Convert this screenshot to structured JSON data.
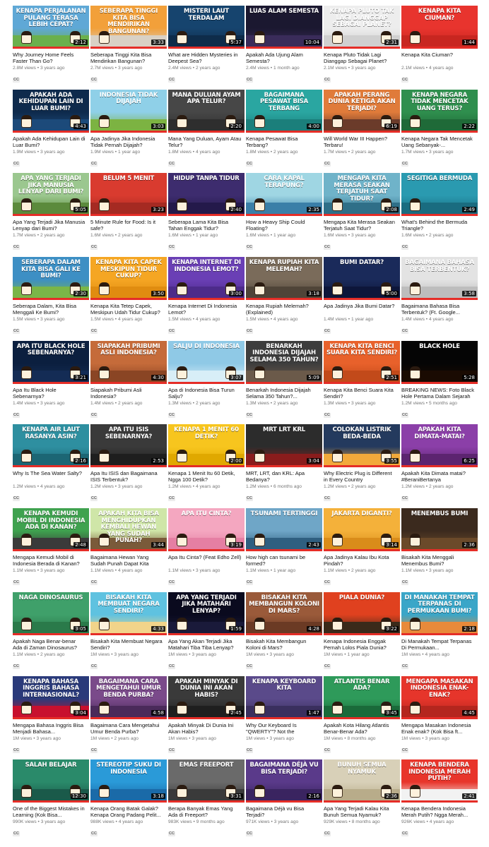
{
  "videos": [
    {
      "title": "Why Journey Home Feels Faster Than Go?",
      "overlay": "KENAPA PERJALANAN PULANG TERASA LEBIH CEPAT?",
      "duration": "2:12",
      "meta": "2.8M views • 3 years ago",
      "badge": "CC",
      "colors": [
        "#5fa8d6",
        "#6ab04c"
      ]
    },
    {
      "title": "Seberapa Tinggi Kita Bisa Mendirikan Bangunan?",
      "overlay": "SEBERAPA TINGGI KITA BISA MENDIRIKAN BANGUNAN?",
      "duration": "3:33",
      "meta": "2.7M views • 3 years ago",
      "badge": "CC",
      "colors": [
        "#f2a03a",
        "#d9d1c5"
      ]
    },
    {
      "title": "What are Hidden Mysteries in Deepest Sea?",
      "overlay": "MISTERI LAUT TERDALAM",
      "duration": "5:37",
      "meta": "2.4M views • 2 years ago",
      "badge": "CC",
      "colors": [
        "#16446e",
        "#0e2c4a"
      ]
    },
    {
      "title": "Apakah Ada Ujung Alam Semesta?",
      "overlay": "LUAS ALAM SEMESTA",
      "duration": "10:04",
      "meta": "2.4M views • 1 month ago",
      "badge": "CC",
      "colors": [
        "#1b1830",
        "#3a2c5a"
      ]
    },
    {
      "title": "Kenapa Pluto Tidak Lagi Dianggap Sebagai Planet?",
      "overlay": "KENAPA PLUTO TAK LAGI DIANGGAP SEBAGAI PLANET?",
      "duration": "2:31",
      "meta": "2.1M views • 3 years ago",
      "badge": "CC",
      "colors": [
        "#ededed",
        "#d0d0d0"
      ]
    },
    {
      "title": "Kenapa Kita Ciuman?",
      "overlay": "KENAPA KITA CIUMAN?",
      "duration": "1:44",
      "meta": "2.1M views • 4 years ago",
      "badge": "CC",
      "colors": [
        "#e8342e",
        "#c82620"
      ]
    },
    {
      "title": "Apakah Ada Kehidupan Lain di Luar Bumi?",
      "overlay": "APAKAH ADA KEHIDUPAN LAIN DI LUAR BUMI?",
      "duration": "4:43",
      "meta": "1.9M views • 3 years ago",
      "badge": "CC",
      "colors": [
        "#0e2a4c",
        "#1c4a7a"
      ]
    },
    {
      "title": "Apa Jadinya Jika Indonesia Tidak Pernah Dijajah?",
      "overlay": "INDONESIA TIDAK DIJAJAH",
      "duration": "3:03",
      "meta": "1.9M views • 1 year ago",
      "badge": "CC",
      "colors": [
        "#8fd0e8",
        "#7cb342"
      ]
    },
    {
      "title": "Mana Yang Duluan, Ayam Atau Telur?",
      "overlay": "MANA DULUAN AYAM APA TELUR?",
      "duration": "2:20",
      "meta": "1.8M views • 4 years ago",
      "badge": "CC",
      "colors": [
        "#474747",
        "#2e2e2e"
      ]
    },
    {
      "title": "Kenapa Pesawat Bisa Terbang?",
      "overlay": "BAGAIMANA PESAWAT BISA TERBANG",
      "duration": "4:00",
      "meta": "1.8M views • 2 years ago",
      "badge": "CC",
      "colors": [
        "#2aa6a1",
        "#1b7f7b"
      ]
    },
    {
      "title": "Will World War III Happen? Terbaru!",
      "overlay": "APAKAH PERANG DUNIA KETIGA AKAN TERJADI?",
      "duration": "6:19",
      "meta": "1.7M views • 2 years ago",
      "badge": "CC",
      "colors": [
        "#e07b3a",
        "#6b3b2a"
      ]
    },
    {
      "title": "Kenapa Negara Tak Mencetak Uang Sebanyak-...",
      "overlay": "KENAPA NEGARA TIDAK MENCETAK UANG TERUS?",
      "duration": "2:22",
      "meta": "1.7M views • 3 years ago",
      "badge": "CC",
      "colors": [
        "#2f8f4e",
        "#1f6a38"
      ]
    },
    {
      "title": "Apa Yang Terjadi Jika Manusia Lenyap dari Bumi?",
      "overlay": "APA YANG TERJADI JIKA MANUSIA LENYAP DARI BUMI?",
      "duration": "5:05",
      "meta": "1.7M views • 2 years ago",
      "badge": "CC",
      "colors": [
        "#9bc78f",
        "#5b8a3c"
      ]
    },
    {
      "title": "5 Minute Rule for Food: Is it safe?",
      "overlay": "BELUM 5 MENIT",
      "duration": "3:23",
      "meta": "1.6M views • 2 years ago",
      "badge": "CC",
      "colors": [
        "#d93b2f",
        "#a52a22"
      ]
    },
    {
      "title": "Seberapa Lama Kita Bisa Tahan Enggak Tidur?",
      "overlay": "HIDUP TANPA TIDUR",
      "duration": "2:40",
      "meta": "1.6M views • 1 year ago",
      "badge": "CC",
      "colors": [
        "#3d2c6e",
        "#24194a"
      ]
    },
    {
      "title": "How a Heavy Ship Could Floating?",
      "overlay": "CARA KAPAL TERAPUNG?",
      "duration": "2:35",
      "meta": "1.6M views • 1 year ago",
      "badge": "CC",
      "colors": [
        "#9fd6e3",
        "#3a7fa8"
      ]
    },
    {
      "title": "Mengapa Kita Merasa Seakan Terjatuh Saat Tidur?",
      "overlay": "MENGAPA KITA MERASA SEAKAN TERJATUH SAAT TIDUR?",
      "duration": "2:08",
      "meta": "1.6M views • 3 years ago",
      "badge": "CC",
      "colors": [
        "#6fb3c9",
        "#2f6f88"
      ]
    },
    {
      "title": "What's Behind the Bermuda Triangle?",
      "overlay": "SEGITIGA BERMUDA",
      "duration": "2:49",
      "meta": "1.6M views • 2 years ago",
      "badge": "CC",
      "colors": [
        "#2a9ab0",
        "#1a6c80"
      ]
    },
    {
      "title": "Seberapa Dalam, Kita Bisa Menggali Ke Bumi?",
      "overlay": "SEBERAPA DALAM KITA BISA GALI KE BUMI?",
      "duration": "2:30",
      "meta": "1.5M views • 3 years ago",
      "badge": "CC",
      "colors": [
        "#3d8fc4",
        "#7ab648"
      ]
    },
    {
      "title": "Kenapa Kita Tetep Capek, Meskipun Udah Tidur Cukup?",
      "overlay": "KENAPA KITA CAPEK MESKIPUN TIDUR CUKUP?",
      "duration": "3:50",
      "meta": "1.5M views • 4 years ago",
      "badge": "CC",
      "colors": [
        "#f5a623",
        "#e08c10"
      ]
    },
    {
      "title": "Kenapa Internet Di Indonesia Lemot?",
      "overlay": "KENAPA INTERNET DI INDONESIA LEMOT?",
      "duration": "3:00",
      "meta": "1.5M views • 4 years ago",
      "badge": "CC",
      "colors": [
        "#6a3fb5",
        "#4d2b8a"
      ]
    },
    {
      "title": "Kenapa Rupiah Melemah? (Explained)",
      "overlay": "KENAPA RUPIAH KITA MELEMAH?",
      "duration": "3:18",
      "meta": "1.5M views • 4 years ago",
      "badge": "CC",
      "colors": [
        "#7a6b5a",
        "#4f4438"
      ]
    },
    {
      "title": "Apa Jadinya Jika Bumi Datar?",
      "overlay": "BUMI DATAR?",
      "duration": "5:00",
      "meta": "1.4M views • 1 year ago",
      "badge": "CC",
      "colors": [
        "#1a2a5a",
        "#0d163a"
      ]
    },
    {
      "title": "Bagaimana Bahasa Bisa Terbentuk? (Ft. Google...",
      "overlay": "BAGAIMANA BAHASA BISA TERBENTUK?",
      "duration": "3:58",
      "meta": "1.4M views • 4 years ago",
      "badge": "CC",
      "colors": [
        "#e3e3e3",
        "#bdbdbd"
      ]
    },
    {
      "title": "Apa Itu Black Hole Sebenarnya?",
      "overlay": "APA ITU BLACK HOLE SEBENARNYA?",
      "duration": "3:21",
      "meta": "1.4M views • 3 years ago",
      "badge": "CC",
      "colors": [
        "#0b1f3f",
        "#142c55"
      ]
    },
    {
      "title": "Siapakah Pribumi Asli Indonesia?",
      "overlay": "SIAPAKAH PRIBUMI ASLI INDONESIA?",
      "duration": "4:30",
      "meta": "1.4M views • 2 years ago",
      "badge": "CC",
      "colors": [
        "#c56b3a",
        "#8a4524"
      ]
    },
    {
      "title": "Apa di Indonesia Bisa Turun Salju?",
      "overlay": "SALJU DI INDONESIA",
      "duration": "3:07",
      "meta": "1.3M views • 2 years ago",
      "badge": "CC",
      "colors": [
        "#8fc9e6",
        "#d8eef7"
      ]
    },
    {
      "title": "Benarkah Indonesia Dijajah Selama 350 Tahun?...",
      "overlay": "BENARKAH INDONESIA DIJAJAH SELAMA 350 TAHUN?",
      "duration": "5:09",
      "meta": "1.3M views • 2 years ago",
      "badge": "CC",
      "colors": [
        "#3d3d3d",
        "#6b5a4a"
      ]
    },
    {
      "title": "Kenapa Kita Benci Suara Kita Sendiri?",
      "overlay": "KENAPA KITA BENCI SUARA KITA SENDIRI?",
      "duration": "2:51",
      "meta": "1.3M views • 3 years ago",
      "badge": "CC",
      "colors": [
        "#e8612b",
        "#c24a1a"
      ]
    },
    {
      "title": "BREAKING NEWS: Foto Black Hole Pertama Dalam Sejarah",
      "overlay": "BLACK HOLE",
      "duration": "5:28",
      "meta": "1.2M views • 5 months ago",
      "badge": "CC",
      "colors": [
        "#050505",
        "#1a0b02"
      ]
    },
    {
      "title": "Why Is The Sea Water Salty?",
      "overlay": "KENAPA AIR LAUT RASANYA ASIN?",
      "duration": "2:16",
      "meta": "1.2M views • 4 years ago",
      "badge": "CC",
      "colors": [
        "#2e8fa0",
        "#1c6674"
      ]
    },
    {
      "title": "Apa Itu ISIS dan Bagaimana ISIS Terbentuk?",
      "overlay": "APA ITU ISIS SEBENARNYA?",
      "duration": "2:53",
      "meta": "1.2M views • 3 years ago",
      "badge": "CC",
      "colors": [
        "#3a3a3a",
        "#1e1e1e"
      ]
    },
    {
      "title": "Kenapa 1 Menit Itu 60 Detik, Ngga 100 Detik?",
      "overlay": "KENAPA 1 MENIT 60 DETIK?",
      "duration": "2:00",
      "meta": "1.2M views • 4 years ago",
      "badge": "CC",
      "colors": [
        "#f7c51e",
        "#e0a800"
      ]
    },
    {
      "title": "MRT, LRT, dan KRL: Apa Bedanya?",
      "overlay": "MRT LRT KRL",
      "duration": "3:04",
      "meta": "1.2M views • 6 months ago",
      "badge": "CC",
      "colors": [
        "#2c2c2c",
        "#8a1c1c"
      ]
    },
    {
      "title": "Why Electric Plug is Different in Every Country",
      "overlay": "COLOKAN LISTRIK BEDA-BEDA",
      "duration": "3:55",
      "meta": "1.2M views • 2 years ago",
      "badge": "CC",
      "colors": [
        "#243a5e",
        "#f2a93b"
      ]
    },
    {
      "title": "Apakah Kita Dimata matai? #BeraniBertanya",
      "overlay": "APAKAH KITA DIMATA-MATAI?",
      "duration": "6:25",
      "meta": "1.2M views • 2 years ago",
      "badge": "CC",
      "colors": [
        "#8b3fa8",
        "#5c2470"
      ]
    },
    {
      "title": "Mengapa Kemudi Mobil di Indonesia Berada di Kanan?",
      "overlay": "KENAPA KEMUDI MOBIL DI INDONESIA ADA DI KANAN?",
      "duration": "2:48",
      "meta": "1.1M views • 3 years ago",
      "badge": "CC",
      "colors": [
        "#3fa24f",
        "#3a3a3a"
      ]
    },
    {
      "title": "Bagaimana Hewan Yang Sudah Punah Dapat Kita Hidupkan...",
      "overlay": "APAKAH KITA BISA MENGHIDUPKAN KEMBALI HEWAN YANG SUDAH PUNAH?",
      "duration": "3:44",
      "meta": "1.1M views • 4 years ago",
      "badge": "CC",
      "colors": [
        "#cfe6a8",
        "#7a5a3a"
      ]
    },
    {
      "title": "Apa Itu Cinta? (Feat Edho Zell)",
      "overlay": "APA ITU CINTA?",
      "duration": "3:19",
      "meta": "1.1M views • 3 years ago",
      "badge": "CC",
      "colors": [
        "#f4a7c0",
        "#e57fa3"
      ]
    },
    {
      "title": "How high can tsunami be formed?",
      "overlay": "TSUNAMI TERTINGGI",
      "duration": "2:43",
      "meta": "1.1M views • 1 year ago",
      "badge": "CC",
      "colors": [
        "#6fa6c7",
        "#2f5f80"
      ]
    },
    {
      "title": "Apa Jadinya Kalau Ibu Kota Pindah?",
      "overlay": "JAKARTA DIGANTI?",
      "duration": "3:14",
      "meta": "1.1M views • 2 years ago",
      "badge": "CC",
      "colors": [
        "#f4b13a",
        "#d98c1a"
      ]
    },
    {
      "title": "Bisakah Kita Menggali Menembus Bumi?",
      "overlay": "MENEMBUS BUMI",
      "duration": "2:36",
      "meta": "1.1M views • 3 years ago",
      "badge": "CC",
      "colors": [
        "#3b2a1e",
        "#6b4a2a"
      ]
    },
    {
      "title": "Apakah Naga Benar-benar Ada di Zaman Dinosaurus?",
      "overlay": "NAGA DINOSAURUS",
      "duration": "3:05",
      "meta": "1.1M views • 2 years ago",
      "badge": "CC",
      "colors": [
        "#3fa06a",
        "#2a7a4a"
      ]
    },
    {
      "title": "Bisakah Kita Membuat Negara Sendiri?",
      "overlay": "BISAKAH KITA MEMBUAT NEGARA SENDIRI?",
      "duration": "4:33",
      "meta": "1M views • 3 years ago",
      "badge": "CC",
      "colors": [
        "#5fc2e0",
        "#f2d48a"
      ]
    },
    {
      "title": "Apa Yang Akan Terjadi Jika Matahari Tiba Tiba Lenyap?",
      "overlay": "APA YANG TERJADI JIKA MATAHARI LENYAP?",
      "duration": "1:59",
      "meta": "1M views • 3 years ago",
      "badge": "CC",
      "colors": [
        "#0a0a1e",
        "#1a1a3a"
      ]
    },
    {
      "title": "Bisakah Kita Membangun Koloni di Mars?",
      "overlay": "BISAKAH KITA MEMBANGUN KOLONI DI MARS?",
      "duration": "4:28",
      "meta": "1M views • 3 years ago",
      "badge": "CC",
      "colors": [
        "#9a5a3a",
        "#6b3a24"
      ]
    },
    {
      "title": "Kenapa Indonesia Enggak Pernah Lolos Piala Dunia?",
      "overlay": "PIALA DUNIA?",
      "duration": "3:22",
      "meta": "1M views • 1 year ago",
      "badge": "CC",
      "colors": [
        "#e0411f",
        "#3a2a1a"
      ]
    },
    {
      "title": "Di Manakah Tempat Terpanas Di Permukaan...",
      "overlay": "DI MANAKAH TEMPAT TERPANAS DI PERMUKAAN BUMI?",
      "duration": "2:18",
      "meta": "1M views • 4 years ago",
      "badge": "CC",
      "colors": [
        "#3aa6c8",
        "#e88a3a"
      ]
    },
    {
      "title": "Mengapa Bahasa Inggris Bisa Menjadi Bahasa...",
      "overlay": "KENAPA BAHASA INGGRIS BAHASA INTERNASIONAL?",
      "duration": "3:04",
      "meta": "1M views • 3 years ago",
      "badge": "CC",
      "colors": [
        "#2a3a7a",
        "#c8102e"
      ]
    },
    {
      "title": "Bagaimana Cara Mengetahui Umur Benda Purba?",
      "overlay": "BAGAIMANA CARA MENGETAHUI UMUR BENDA PURBA?",
      "duration": "4:58",
      "meta": "1M views • 2 years ago",
      "badge": "CC",
      "colors": [
        "#7a4a8a",
        "#4a2a5a"
      ]
    },
    {
      "title": "Apakah Minyak Di Dunia Ini Akan Habis?",
      "overlay": "APAKAH MINYAK DI DUNIA INI AKAN HABIS?",
      "duration": "2:45",
      "meta": "1M views • 3 years ago",
      "badge": "CC",
      "colors": [
        "#3a3a3a",
        "#1f1f1f"
      ]
    },
    {
      "title": "Why Our Keyboard Is \"QWERTY\"? Not the \"ABCDE\"?",
      "overlay": "KENAPA KEYBOARD KITA",
      "duration": "1:47",
      "meta": "1M views • 3 years ago",
      "badge": "CC",
      "colors": [
        "#5a4a8a",
        "#3a2f5e"
      ]
    },
    {
      "title": "Apakah Kota Hilang Atlantis Benar-Benar Ada?",
      "overlay": "ATLANTIS BENAR ADA?",
      "duration": "3:45",
      "meta": "1M views • 8 months ago",
      "badge": "CC",
      "colors": [
        "#2e9a5a",
        "#1a6a3a"
      ]
    },
    {
      "title": "Mengapa Masakan Indonesia Enak enak? (Kok Bisa ft...",
      "overlay": "MENGAPA MASAKAN INDONESIA ENAK-ENAK?",
      "duration": "4:45",
      "meta": "1M views • 3 years ago",
      "badge": "CC",
      "colors": [
        "#e6352b",
        "#b4261e"
      ]
    },
    {
      "title": "One of the Biggest Mistakes in Learning (Kok Bisa...",
      "overlay": "SALAH BELAJAR",
      "duration": "12:30",
      "meta": "990K views • 3 years ago",
      "badge": "CC",
      "colors": [
        "#2a8a6a",
        "#1a5a4a"
      ]
    },
    {
      "title": "Kenapa Orang Batak Galak? Kenapa Orang Padang Pelit...",
      "overlay": "STEREOTIP SUKU DI INDONESIA",
      "duration": "3:18",
      "meta": "988K views • 4 years ago",
      "badge": "CC",
      "colors": [
        "#2a9ad8",
        "#1a6aa8"
      ]
    },
    {
      "title": "Berapa Banyak Emas Yang Ada di Freeport?",
      "overlay": "EMAS FREEPORT",
      "duration": "3:31",
      "meta": "983K views • 9 months ago",
      "badge": "CC",
      "colors": [
        "#6a6a6a",
        "#3a3a3a"
      ]
    },
    {
      "title": "Bagaimana Déjà vu Bisa Terjadi?",
      "overlay": "BAGAIMANA DÉJÀ VU BISA TERJADI?",
      "duration": "2:16",
      "meta": "971K views • 3 years ago",
      "badge": "CC",
      "colors": [
        "#5a3a8a",
        "#3a2460"
      ]
    },
    {
      "title": "Apa Yang Terjadi Kalau Kita Bunuh Semua Nyamuk?",
      "overlay": "BUNUH SEMUA NYAMUK",
      "duration": "2:36",
      "meta": "929K views • 8 months ago",
      "badge": "CC",
      "colors": [
        "#d8d0b8",
        "#b8ac8a"
      ]
    },
    {
      "title": "Kenapa Bendera Indonesia Merah Putih? Ngga Merah...",
      "overlay": "KENAPA BENDERA INDONESIA MERAH PUTIH?",
      "duration": "2:41",
      "meta": "926K views • 4 years ago",
      "badge": "CC",
      "colors": [
        "#e8352b",
        "#f2f2f2"
      ]
    }
  ]
}
